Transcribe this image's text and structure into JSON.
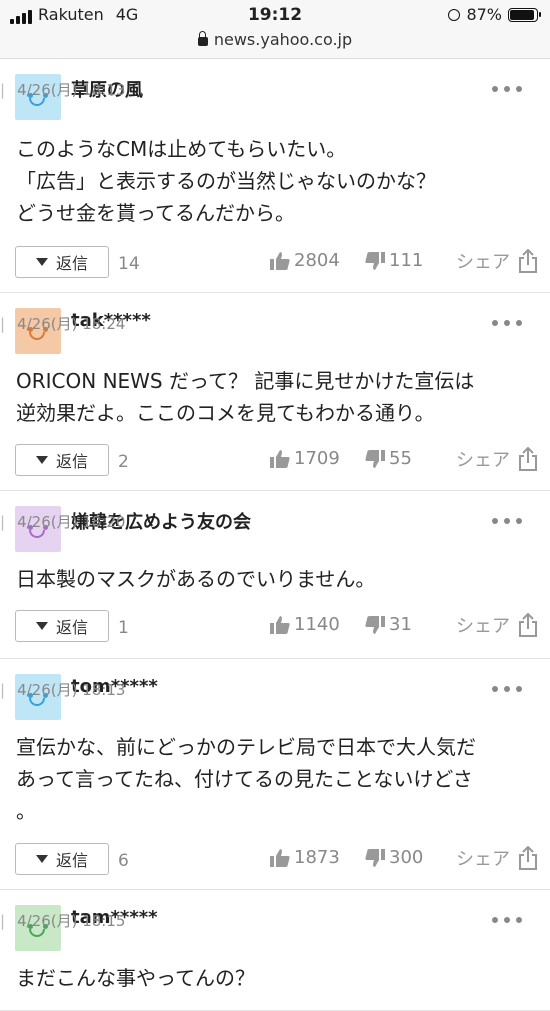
{
  "status": {
    "carrier": "Rakuten",
    "network": "4G",
    "time": "19:12",
    "battery": "87%",
    "battery_level": 0.87,
    "url": "news.yahoo.co.jp"
  },
  "labels": {
    "reply": "返信",
    "share": "シェア"
  },
  "colors": {
    "avatar_blue": "#bfe6f7",
    "avatar_orange": "#f6c9a6",
    "avatar_purple": "#e6d3f2",
    "avatar_green": "#c8e8c8"
  },
  "comments": [
    {
      "author": "草原の風",
      "time": "4/26(月) 18:13",
      "avatar": "smiley-blue-icon",
      "text": "このようなCMは止めてもらいたい。\n「広告」と表示するのが当然じゃないのかな？\nどうせ金を貰ってるんだから。",
      "replies": "14",
      "likes": "2804",
      "dislikes": "111"
    },
    {
      "author": "tak*****",
      "time": "4/26(月) 18:24",
      "avatar": "smiley-orange-icon",
      "text": "ORICON NEWS だって？ 記事に見せかけた宣伝は\n逆効果だよ。ここのコメを見てもわかる通り。",
      "replies": "2",
      "likes": "1709",
      "dislikes": "55"
    },
    {
      "author": "嫌韓を広めよう友の会",
      "time": "4/26(月) 18:20",
      "avatar": "smiley-purple-icon",
      "text": "日本製のマスクがあるのでいりません。",
      "replies": "1",
      "likes": "1140",
      "dislikes": "31"
    },
    {
      "author": "tom*****",
      "time": "4/26(月) 18:13",
      "avatar": "smiley-blue-icon",
      "text": "宣伝かな、前にどっかのテレビ局で日本で大人気だ\nあって言ってたね、付けてるの見たことないけどさ\n。",
      "replies": "6",
      "likes": "1873",
      "dislikes": "300"
    },
    {
      "author": "tam*****",
      "time": "4/26(月) 18:15",
      "avatar": "smiley-green-icon",
      "text": "まだこんな事やってんの？"
    }
  ]
}
